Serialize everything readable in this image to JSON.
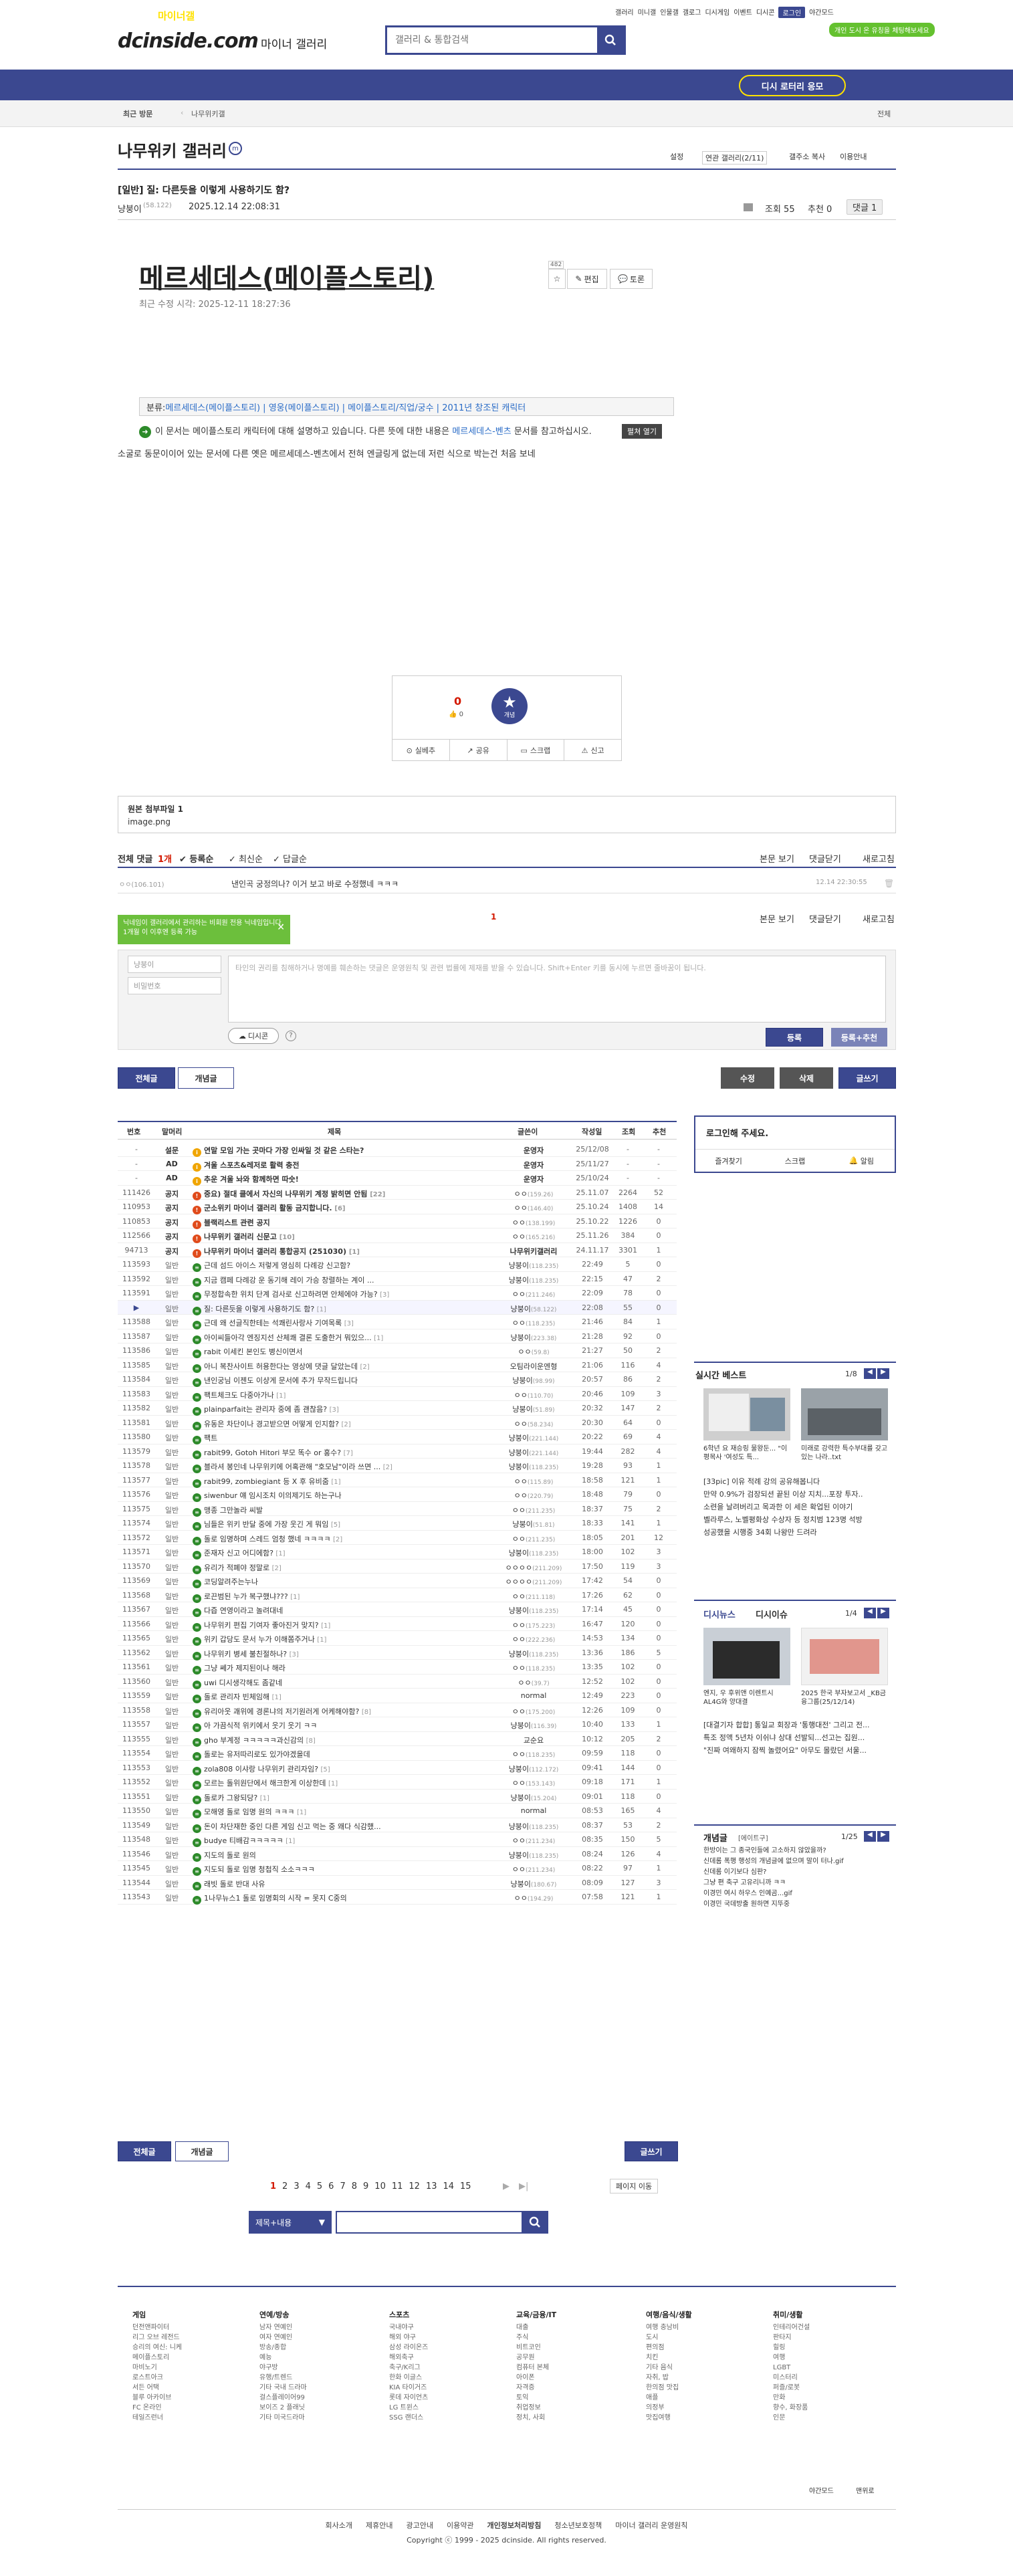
{
  "topbar": {
    "links": [
      "갤러리",
      "미니갤",
      "인물갤",
      "갤로그",
      "디시게임",
      "이벤트",
      "디시콘"
    ],
    "login": "로그인",
    "nightmode": "야간모드",
    "green_badge": "개인 도시 온 유칭을 체팅해보세요"
  },
  "logo": {
    "text": "dcinside.com",
    "sub": "마이너 갤러리"
  },
  "search": {
    "placeholder": "갤러리 & 통합검색"
  },
  "gnb": {
    "items": [
      "갤러리",
      "마이너갤",
      "미니갤",
      "인물갤",
      "갤로그"
    ],
    "button": "디시 로터리 응모"
  },
  "crumb": {
    "recent": "최근 방문",
    "item": "나무위키갤",
    "all": "전체"
  },
  "gallery": {
    "title": "나무위키 갤러리",
    "icon": "m",
    "settings": "설정",
    "related": "연관 갤러리(2/11)",
    "mgr": "갤주소 복사",
    "move": "이용안내"
  },
  "post": {
    "title": "[일반] 질: 다른듯을 이렇게 사용하기도 함?",
    "author": "냥붕이",
    "ip": "(58.122)",
    "date": "2025.12.14 22:08:31",
    "views": "조회 55",
    "rec": "추천 0",
    "comments": "댓글 1"
  },
  "wiki": {
    "title": "메르세데스(메이플스토리)",
    "date": "최근 수정 시각: 2025-12-11 18:27:36",
    "count": "482",
    "btn_star": "☆",
    "btn_edit": "편집",
    "btn_discuss": "토론",
    "cat_label": "분류:",
    "cats": [
      "메르세데스(메이플스토리)",
      "영웅(메이플스토리)",
      "메이플스토리/직업/궁수",
      "2011년 창조된 캐릭터"
    ],
    "note_prefix": "이 문서는 메이플스토리 캐릭터에 대해 설명하고 있습니다. 다른 뜻에 대한 내용은 ",
    "note_link": "메르세데스-벤츠",
    "note_suffix": " 문서를 참고하십시오.",
    "open": "펼쳐 열기",
    "body": "소굴로 동문이이어 있는 문서에 다른 옛은 메르세데스-벤츠에서 전혀 엔글링게 없는데 저런 식으로 박는건 처음 보네"
  },
  "recommend": {
    "up": "0",
    "down": "0",
    "gaenyum": "개념",
    "actions": [
      "실베추",
      "공유",
      "스크랩",
      "신고"
    ]
  },
  "attach": {
    "title": "원본 첨부파일 1",
    "file": "image.png"
  },
  "comments": {
    "total_label": "전체 댓글",
    "total": "1개",
    "sort": [
      "등록순",
      "최신순",
      "답글순"
    ],
    "view": "본문 보기",
    "fold": "댓글닫기",
    "refresh": "새로고침",
    "items": [
      {
        "author": "ㅇㅇ(106.101)",
        "text": "낸인곡 궁정의나? 이거 보고 바로 수정했네 ㅋㅋㅋ",
        "date": "12.14 22:30:55"
      }
    ],
    "pager": "1",
    "tooltip": "닉네임이 갤러리에서 관리하는 비회원 전용 닉네임입니다. 1개월 이 이후엔 등록 가능",
    "nick_ph": "냥붕이",
    "pw_ph": "비밀번호",
    "area_ph": "타인의 권리를 침해하거나 명예를 훼손하는 댓글은 운영원칙 및 관련 법률에 제재를 받을 수 있습니다. Shift+Enter 키를 동시에 누르면 줄바꿈이 됩니다.",
    "dccon": "디시콘",
    "submit": "등록",
    "submit_rec": "등록+추천"
  },
  "listbar": {
    "all": "전체글",
    "concept": "개념글",
    "edit": "수정",
    "delete": "삭제",
    "write": "글쓰기"
  },
  "list": {
    "headers": [
      "번호",
      "말머리",
      "제목",
      "글쓴이",
      "작성일",
      "조회",
      "추천"
    ],
    "rows": [
      {
        "num": "-",
        "head": "설문",
        "title": "연말 모임 가는 곳마다 가장 인싸일 것 같은 스타는?",
        "writer": "운영자",
        "date": "25/12/08",
        "views": "-",
        "rec": "-",
        "notice": true,
        "icon": "yel"
      },
      {
        "num": "-",
        "head": "AD",
        "title": "겨울 스포츠&레저로 활력 충전",
        "writer": "운영자",
        "date": "25/11/27",
        "views": "-",
        "rec": "-",
        "notice": true,
        "icon": "yel"
      },
      {
        "num": "-",
        "head": "AD",
        "title": "추운 겨울 놔와 함께하면 따숫!",
        "writer": "운영자",
        "date": "25/10/24",
        "views": "-",
        "rec": "-",
        "notice": true,
        "icon": "yel"
      },
      {
        "num": "111426",
        "head": "공지",
        "title": "중요) 절대 클에서 자신의 나무위키 계정 밝히면 안됨",
        "cnt": "[22]",
        "writer": "ㅇㅇ",
        "ip": "(159.26)",
        "date": "25.11.07",
        "views": "2264",
        "rec": "52",
        "notice": true,
        "icon": "red"
      },
      {
        "num": "110953",
        "head": "공지",
        "title": "군소위키 마이너 갤러리 활동 금지합니다.",
        "cnt": "[6]",
        "writer": "ㅇㅇ",
        "ip": "(146.40)",
        "date": "25.10.24",
        "views": "1408",
        "rec": "14",
        "notice": true,
        "icon": "red"
      },
      {
        "num": "110853",
        "head": "공지",
        "title": "블랙리스트 관련 공지",
        "writer": "ㅇㅇ",
        "ip": "(138.199)",
        "date": "25.10.22",
        "views": "1226",
        "rec": "0",
        "notice": true,
        "icon": "red"
      },
      {
        "num": "112566",
        "head": "공지",
        "title": "나무위키 갤러리 신문고",
        "cnt": "[10]",
        "writer": "ㅇㅇ",
        "ip": "(165.216)",
        "date": "25.11.26",
        "views": "384",
        "rec": "0",
        "notice": true,
        "icon": "red"
      },
      {
        "num": "94713",
        "head": "공지",
        "title": "나무위키 마이너 갤러리 통합공지 (251030)",
        "cnt": "[1]",
        "writer": "나무위키갤러리",
        "date": "24.11.17",
        "views": "3301",
        "rec": "1",
        "notice": true,
        "icon": "red"
      },
      {
        "num": "113593",
        "head": "일반",
        "title": "근데 섬드 아이스 저렇게 영심히 다례강 신고함?",
        "writer": "냥붕이",
        "ip": "(118.235)",
        "date": "22:49",
        "views": "5",
        "rec": "0"
      },
      {
        "num": "113592",
        "head": "일반",
        "title": "지금 캠페 다례강 운 동기해 레이 가승 창렬하는 계이 ...",
        "writer": "냥붕이",
        "ip": "(118.235)",
        "date": "22:15",
        "views": "47",
        "rec": "2"
      },
      {
        "num": "113591",
        "head": "일반",
        "title": "무정합속한 위치 단계 검사로 신고하려면 안체에야 가능?",
        "cnt": "[3]",
        "writer": "ㅇㅇ",
        "ip": "(211.246)",
        "date": "22:09",
        "views": "78",
        "rec": "0"
      },
      {
        "num": "113590",
        "head": "일반",
        "title": "질: 다른듯을 이렇게 사용하기도 함?",
        "cnt": "[1]",
        "writer": "냥붕이",
        "ip": "(58.122)",
        "date": "22:08",
        "views": "55",
        "rec": "0",
        "current": true
      },
      {
        "num": "113588",
        "head": "일반",
        "title": "근데 왜 선글직한테는 석쾌린사랑사 기여목록",
        "cnt": "[3]",
        "writer": "ㅇㅇ",
        "ip": "(118.235)",
        "date": "21:46",
        "views": "84",
        "rec": "1"
      },
      {
        "num": "113587",
        "head": "일반",
        "title": "아이씨들아각 엔징지선 산체쾌 결론 도출한거 뭐있으...",
        "cnt": "[1]",
        "writer": "냥붕이",
        "ip": "(223.38)",
        "date": "21:28",
        "views": "92",
        "rec": "0"
      },
      {
        "num": "113586",
        "head": "일반",
        "title": "rabit 이세킨 본인도 병신이면서",
        "writer": "ㅇㅇ",
        "ip": "(59.8)",
        "date": "21:27",
        "views": "50",
        "rec": "2"
      },
      {
        "num": "113585",
        "head": "일반",
        "title": "아니 복찬사이트 허용한다는 영상에 댓글 달았는데",
        "cnt": "[2]",
        "writer": "오팀라이운엔형",
        "date": "21:06",
        "views": "116",
        "rec": "4"
      },
      {
        "num": "113584",
        "head": "일반",
        "title": "낸인궁님 이젠도 이샹게 문서에 추가 무작드립니다",
        "writer": "냥붕이",
        "ip": "(98.99)",
        "date": "20:57",
        "views": "86",
        "rec": "2"
      },
      {
        "num": "113583",
        "head": "일반",
        "title": "팩트체크도 다중아가나",
        "cnt": "[1]",
        "writer": "ㅇㅇ",
        "ip": "(110.70)",
        "date": "20:46",
        "views": "109",
        "rec": "3"
      },
      {
        "num": "113582",
        "head": "일반",
        "title": "plainparfait는 관리자 중에 좀 괜찮음?",
        "cnt": "[3]",
        "writer": "냥붕이",
        "ip": "(51.89)",
        "date": "20:32",
        "views": "147",
        "rec": "2"
      },
      {
        "num": "113581",
        "head": "일반",
        "title": "유동은 차단이나 경고받으면 어떻게 인지함?",
        "cnt": "[2]",
        "writer": "ㅇㅇ",
        "ip": "(58.234)",
        "date": "20:30",
        "views": "64",
        "rec": "0"
      },
      {
        "num": "113580",
        "head": "일반",
        "title": "팩트",
        "writer": "냥붕이",
        "ip": "(221.144)",
        "date": "20:22",
        "views": "69",
        "rec": "4"
      },
      {
        "num": "113579",
        "head": "일반",
        "title": "rabit99, Gotoh Hitori 부모 똑수 or 홍수?",
        "cnt": "[7]",
        "writer": "냥붕이",
        "ip": "(221.144)",
        "date": "19:44",
        "views": "282",
        "rec": "4"
      },
      {
        "num": "113578",
        "head": "일반",
        "title": "블라셔 봉인네 나무위키에 어혹관해 \"호모남\"이라 쓰면 ...",
        "cnt": "[2]",
        "writer": "냥붕이",
        "ip": "(118.235)",
        "date": "19:28",
        "views": "93",
        "rec": "1"
      },
      {
        "num": "113577",
        "head": "일반",
        "title": "rabit99, zombiegiant 등 X 후 유비줌",
        "cnt": "[1]",
        "writer": "ㅇㅇ",
        "ip": "(115.89)",
        "date": "18:58",
        "views": "121",
        "rec": "1"
      },
      {
        "num": "113576",
        "head": "일반",
        "title": "siwenbur 얘 임시조치 이의제기도 하는구나",
        "writer": "ㅇㅇ",
        "ip": "(220.79)",
        "date": "18:48",
        "views": "79",
        "rec": "0"
      },
      {
        "num": "113575",
        "head": "일반",
        "title": "맹종 그만놀라 씨발",
        "writer": "ㅇㅇ",
        "ip": "(211.235)",
        "date": "18:37",
        "views": "75",
        "rec": "2"
      },
      {
        "num": "113574",
        "head": "일반",
        "title": "님들은 위키 반달 중에 가장 웃긴 게 뭐임",
        "cnt": "[5]",
        "writer": "냥붕이",
        "ip": "(51.81)",
        "date": "18:33",
        "views": "141",
        "rec": "1"
      },
      {
        "num": "113572",
        "head": "일반",
        "title": "돌로 임명하며 스레드 엄청 했네 ㅋㅋㅋㅋ",
        "cnt": "[2]",
        "writer": "ㅇㅇ",
        "ip": "(211.235)",
        "date": "18:05",
        "views": "201",
        "rec": "12"
      },
      {
        "num": "113571",
        "head": "일반",
        "title": "준재자 신고 어디에함?",
        "cnt": "[1]",
        "writer": "냥붕이",
        "ip": "(118.235)",
        "date": "18:00",
        "views": "102",
        "rec": "3"
      },
      {
        "num": "113570",
        "head": "일반",
        "title": "유리가 적폐야 정말로",
        "cnt": "[2]",
        "writer": "ㅇㅇㅇㅇ",
        "ip": "(211.209)",
        "date": "17:50",
        "views": "119",
        "rec": "3"
      },
      {
        "num": "113569",
        "head": "일반",
        "title": "코딩알려주는누나",
        "writer": "ㅇㅇㅇㅇ",
        "ip": "(211.209)",
        "date": "17:42",
        "views": "54",
        "rec": "0"
      },
      {
        "num": "113568",
        "head": "일반",
        "title": "로끈범된 누가 복구했냐???",
        "cnt": "[1]",
        "writer": "ㅇㅇ",
        "ip": "(211.118)",
        "date": "17:26",
        "views": "62",
        "rec": "0"
      },
      {
        "num": "113567",
        "head": "일반",
        "title": "다즙 연영이라고 놀려대네",
        "writer": "냥붕이",
        "ip": "(118.235)",
        "date": "17:14",
        "views": "45",
        "rec": "0"
      },
      {
        "num": "113566",
        "head": "일반",
        "title": "나무위키 편집 기여자 좋아진거 맞지?",
        "cnt": "[1]",
        "writer": "ㅇㅇ",
        "ip": "(175.223)",
        "date": "16:47",
        "views": "120",
        "rec": "0"
      },
      {
        "num": "113565",
        "head": "일반",
        "title": "위키 갑당도 문서 누가 이해쫌주거나",
        "cnt": "[1]",
        "writer": "ㅇㅇ",
        "ip": "(222.236)",
        "date": "14:53",
        "views": "134",
        "rec": "0"
      },
      {
        "num": "113562",
        "head": "일반",
        "title": "나무위키 병세 불친절하나?",
        "cnt": "[3]",
        "writer": "냥붕이",
        "ip": "(118.235)",
        "date": "13:36",
        "views": "186",
        "rec": "5"
      },
      {
        "num": "113561",
        "head": "일반",
        "title": "그냥 쎄가 제지된이나 해라",
        "writer": "ㅇㅇ",
        "ip": "(118.235)",
        "date": "13:35",
        "views": "102",
        "rec": "0"
      },
      {
        "num": "113560",
        "head": "일반",
        "title": "uwi 디시생각해도 좀같네",
        "writer": "ㅇㅇ",
        "ip": "(39.7)",
        "date": "12:52",
        "views": "102",
        "rec": "0"
      },
      {
        "num": "113559",
        "head": "일반",
        "title": "돌로 관리자 빈체임해",
        "cnt": "[1]",
        "writer": "normal",
        "date": "12:49",
        "views": "223",
        "rec": "0",
        "icon": "grn"
      },
      {
        "num": "113558",
        "head": "일반",
        "title": "유리아웃 괘위에 경론냐의 저기원러게 어케해야함?",
        "cnt": "[8]",
        "writer": "ㅇㅇ",
        "ip": "(175.200)",
        "date": "12:26",
        "views": "109",
        "rec": "0"
      },
      {
        "num": "113557",
        "head": "일반",
        "title": "아 가끔식적 위키에서 웃기 웃기 ㅋㅋ",
        "writer": "냥붕이",
        "ip": "(116.39)",
        "date": "10:40",
        "views": "133",
        "rec": "1"
      },
      {
        "num": "113555",
        "head": "일반",
        "title": "gho 부계정 ㅋㅋㅋㅋㅋ과신감의",
        "cnt": "[8]",
        "writer": "교순요",
        "date": "10:12",
        "views": "205",
        "rec": "2",
        "icon": "grn"
      },
      {
        "num": "113554",
        "head": "일반",
        "title": "돌로는 유저따리로도 있가야겠을데",
        "writer": "ㅇㅇ",
        "ip": "(118.235)",
        "date": "09:59",
        "views": "118",
        "rec": "0",
        "icon": "grn"
      },
      {
        "num": "113553",
        "head": "일반",
        "title": "zola808 이샤랑 나무위키 관리자임?",
        "cnt": "[5]",
        "writer": "냥붕이",
        "ip": "(112.172)",
        "date": "09:41",
        "views": "144",
        "rec": "0"
      },
      {
        "num": "113552",
        "head": "일반",
        "title": "모르는 돌위원단에서 해크한게 이상한데",
        "cnt": "[1]",
        "writer": "ㅇㅇ",
        "ip": "(153.143)",
        "date": "09:18",
        "views": "171",
        "rec": "1",
        "icon": "grn"
      },
      {
        "num": "113551",
        "head": "일반",
        "title": "돌로카 그왕되당?",
        "cnt": "[1]",
        "writer": "냥붕이",
        "ip": "(15.204)",
        "date": "09:01",
        "views": "118",
        "rec": "0"
      },
      {
        "num": "113550",
        "head": "일반",
        "title": "모해영 돌로 임명 원의 ㅋㅋㅋ",
        "cnt": "[1]",
        "writer": "normal",
        "date": "08:53",
        "views": "165",
        "rec": "4",
        "icon": "grn"
      },
      {
        "num": "113549",
        "head": "일반",
        "title": "돈이 차단재한 중인 다른 게임 신고 먹는 중 왜다 식감했...",
        "writer": "냥붕이",
        "ip": "(118.235)",
        "date": "08:37",
        "views": "53",
        "rec": "2"
      },
      {
        "num": "113548",
        "head": "일반",
        "title": "budye 티배감ㅋㅋㅋㅋㅋ",
        "cnt": "[1]",
        "writer": "ㅇㅇ",
        "ip": "(211.234)",
        "date": "08:35",
        "views": "150",
        "rec": "5"
      },
      {
        "num": "113546",
        "head": "일반",
        "title": "지도의 돌로 원의",
        "writer": "냥붕이",
        "ip": "(118.235)",
        "date": "08:24",
        "views": "126",
        "rec": "4",
        "icon": "grn"
      },
      {
        "num": "113545",
        "head": "일반",
        "title": "지도되 돌로 임명 청첩직 소소ㅋㅋㅋ",
        "writer": "ㅇㅇ",
        "ip": "(211.234)",
        "date": "08:22",
        "views": "97",
        "rec": "1",
        "icon": "grn"
      },
      {
        "num": "113544",
        "head": "일반",
        "title": "래빗 돌로 반대 사유",
        "writer": "냥붕이",
        "ip": "(180.67)",
        "date": "08:09",
        "views": "127",
        "rec": "3",
        "icon": "grn"
      },
      {
        "num": "113543",
        "head": "일반",
        "title": "1나무뉴스1 돌로 임명회의 시작 = 못지 C중의",
        "writer": "ㅇㅇ",
        "ip": "(194.29)",
        "date": "07:58",
        "views": "121",
        "rec": "1",
        "icon": "grn"
      }
    ]
  },
  "pagination": {
    "pages": [
      "1",
      "2",
      "3",
      "4",
      "5",
      "6",
      "7",
      "8",
      "9",
      "10",
      "11",
      "12",
      "13",
      "14",
      "15"
    ],
    "next": "▶",
    "end": "▶|",
    "jump": "페이지 이동"
  },
  "search_bottom": {
    "select": "제목+내용",
    "placeholder": ""
  },
  "right": {
    "login": {
      "title": "로그인해 주세요.",
      "items": [
        "즐겨찾기",
        "스크랩",
        "알림"
      ]
    },
    "best": {
      "title": "실시간 베스트",
      "page": "1/8",
      "caps": [
        "6학년 요 재승링 물왕둔... \"이평목사 '여성도 특...",
        "미래로 강력한 특수부대를 갖고 있는 나라..txt"
      ],
      "links": [
        "[33pic] 이유 적례 강의 공유해봅니다",
        "만약 0.9%가 검장되션 끝된 이상 지치...포장 투자..",
        "소련을 날려버리고 목과한 이 세은 확업된 이야기",
        "벨라루스, 노벨평화상 수상자 등 정치범 123명 석방",
        "성공했을 시행중 34회 나왕만 드려라"
      ]
    },
    "dicition": {
      "title": "디시뉴스",
      "sub": "디시이슈",
      "page": "1/4",
      "caps": [
        "엔지, 우 후위앤 이렌트시 AL4G와 양대결",
        "2025 한국 부자보고서 _KB금융그룹(25/12/14)"
      ],
      "links": [
        "[대결기자 합합] 통일교 회장과 '통행대전' 그리고 전...",
        "특조 정액 5년차 이쉬냐 상대 선발되...선고는 집원...",
        "\"진짜 여왜하지 잠찍 놀렸어요\" 아무도 몰랐던 서울..."
      ]
    },
    "concept": {
      "title": "개념글",
      "sub": "[에이트구]",
      "page": "1/25",
      "links": [
        "한방이는 그 종국인들에 고소하지 않았을까?",
        "신데롬 폭행 행성의 개념글에 없으며 말이 터나.gif",
        "신데롬 이기보다 심판?",
        "그냥 편 축구 고유리니까 ㅋㅋ",
        "이경민 여시 하우스 인예곰...gif",
        "이경민 국데방출 원하면 지뚜중"
      ]
    }
  },
  "footer": {
    "cols": [
      {
        "title": "게임",
        "items": [
          "던전앤파이터",
          "리그 오브 레전드",
          "승리의 여신: 니케",
          "메이플스토리",
          "마비노기",
          "로스트아크",
          "서든 어택",
          "블루 아카이브",
          "FC 온라인",
          "테일즈런너"
        ]
      },
      {
        "title": "연예/방송",
        "items": [
          "남자 연예인",
          "여자 연예인",
          "방송/종합",
          "예능",
          "야구방",
          "유행/트렌드",
          "기타 국내 드라마",
          "걸스플레이어99",
          "보이즈 2 플래닛",
          "기타 미국드라마"
        ]
      },
      {
        "title": "스포츠",
        "items": [
          "국내야구",
          "해외 야구",
          "삼성 라이온즈",
          "해외축구",
          "축구/K리그",
          "한화 이글스",
          "KIA 타이거즈",
          "롯데 자이언츠",
          "LG 트윈스",
          "SSG 랜더스"
        ]
      },
      {
        "title": "교육/금융/IT",
        "items": [
          "대출",
          "주식",
          "비트코인",
          "공무원",
          "컴퓨터 본체",
          "아이폰",
          "자격증",
          "토익",
          "취업정보",
          "정치, 사회"
        ]
      },
      {
        "title": "여행/음식/생활",
        "items": [
          "여행 충남비",
          "도시",
          "편의점",
          "치킨",
          "기타 음식",
          "자취, 밥",
          "한의점 맛집",
          "애플",
          "의정부",
          "맛집여행"
        ]
      },
      {
        "title": "취미/생활",
        "items": [
          "인테리어건설",
          "판타지",
          "힐링",
          "여행",
          "LGBT",
          "미스터리",
          "퍼즐/로봇",
          "만화",
          "향수, 화장품",
          "인문"
        ]
      }
    ],
    "night": "야간모드",
    "top": "맨위로",
    "links": [
      "회사소개",
      "제휴안내",
      "광고안내",
      "이용약관",
      "개인정보처리방침",
      "청소년보호정책",
      "마이너 갤러리 운영원칙"
    ],
    "copyright": "Copyright ⓒ 1999 - 2025 dcinside. All rights reserved."
  }
}
